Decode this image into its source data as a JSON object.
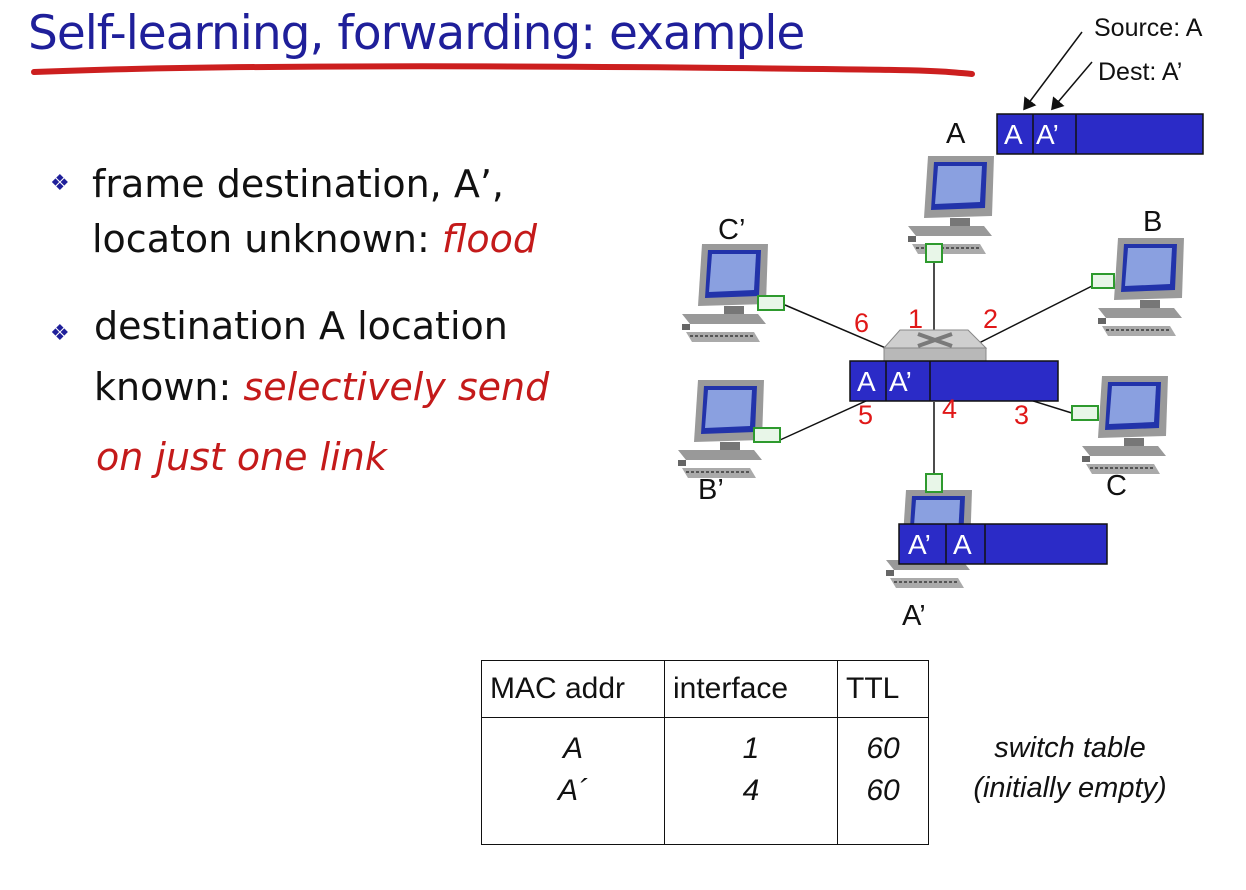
{
  "title": "Self-learning, forwarding: example",
  "bullets": [
    {
      "line1": "frame destination, A’,",
      "line2_plain": "locaton unknown: ",
      "line2_em": "flood"
    },
    {
      "line1": "destination A location",
      "line2_plain": "known: ",
      "line2_em": "selectively send",
      "line3_em": "on just one link"
    }
  ],
  "annotations": {
    "source": "Source: A",
    "dest": "Dest: A’"
  },
  "hosts": {
    "A": "A",
    "B": "B",
    "C": "C",
    "A_prime": "A’",
    "B_prime": "B’",
    "C_prime": "C’"
  },
  "ports": [
    "1",
    "2",
    "3",
    "4",
    "5",
    "6"
  ],
  "frames": {
    "top": {
      "f1": "A",
      "f2": "A’"
    },
    "switch": {
      "f1": "A",
      "f2": "A’"
    },
    "bottom": {
      "f1": "A’",
      "f2": "A"
    }
  },
  "switch_table": {
    "headers": [
      "MAC addr",
      "interface",
      "TTL"
    ],
    "rows": [
      {
        "mac": "A",
        "iface": "1",
        "ttl": "60"
      },
      {
        "mac": "A´",
        "iface": "4",
        "ttl": "60"
      }
    ]
  },
  "caption": {
    "line1": "switch table",
    "line2": "(initially empty)"
  },
  "colors": {
    "title": "#1f1f9a",
    "underline": "#cc1f1f",
    "emphasis": "#c41a1a",
    "frame": "#2b2bc7",
    "port_label": "#e01818",
    "link_stub": "#2e9a2e"
  },
  "icons": [
    "computer-icon",
    "switch-icon",
    "bullet-diamond-icon"
  ]
}
